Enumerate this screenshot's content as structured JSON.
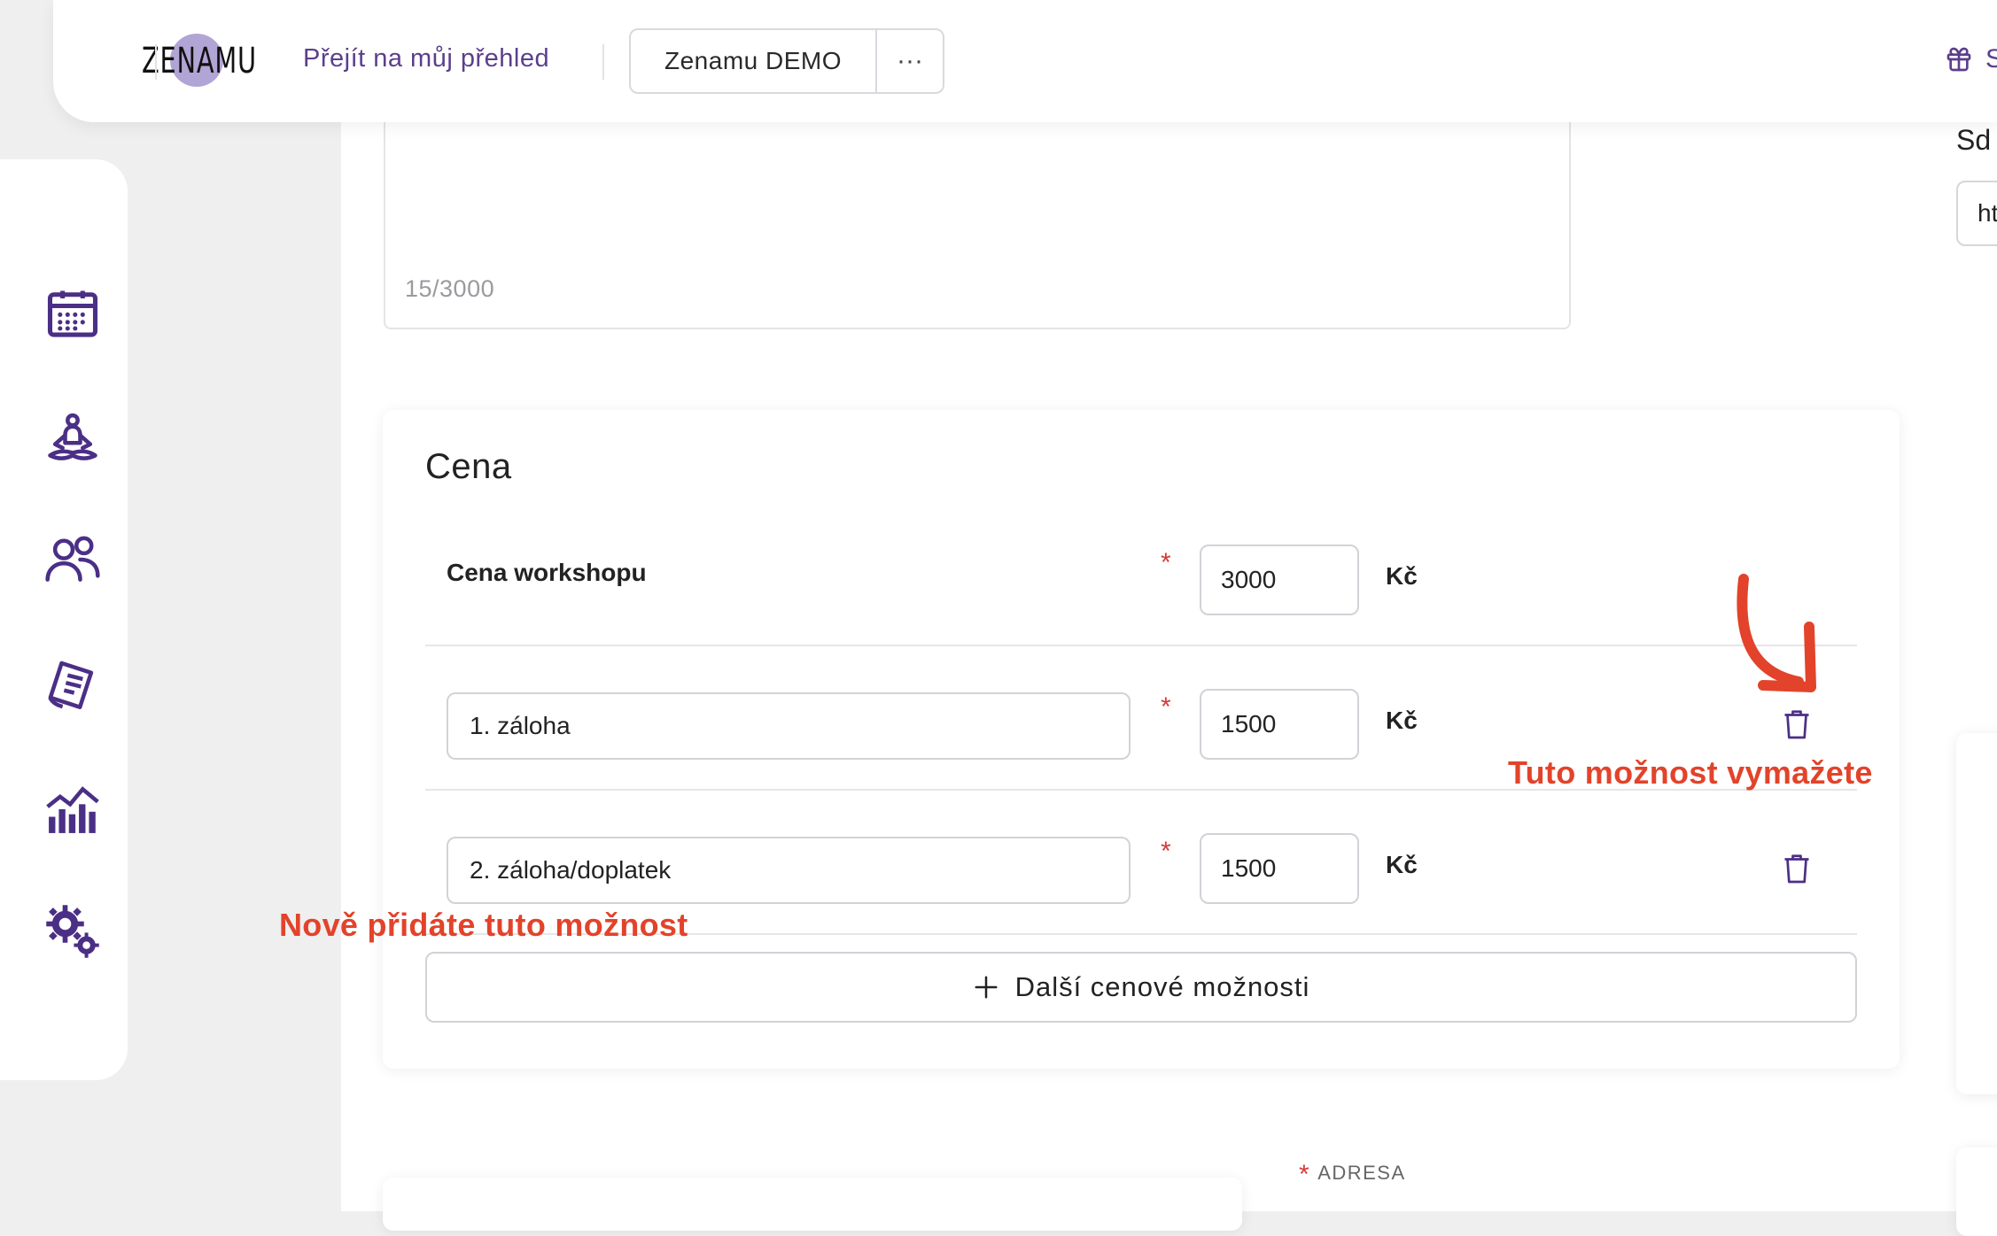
{
  "header": {
    "logo_text": "ZENAMU",
    "overview_link": "Přejít na můj přehled",
    "org_name": "Zenamu DEMO",
    "org_more": "···",
    "manage_link": "Sprá"
  },
  "sidebar": {
    "items": [
      {
        "icon": "calendar-icon"
      },
      {
        "icon": "meditation-icon"
      },
      {
        "icon": "users-icon"
      },
      {
        "icon": "document-icon"
      },
      {
        "icon": "stats-icon"
      },
      {
        "icon": "settings-icon"
      }
    ]
  },
  "description": {
    "counter": "15/3000"
  },
  "price": {
    "title": "Cena",
    "required_mark": "*",
    "rows": [
      {
        "label": "Cena workshopu",
        "amount": "3000",
        "currency": "Kč"
      },
      {
        "label": "1. záloha",
        "amount": "1500",
        "currency": "Kč"
      },
      {
        "label": "2. záloha/doplatek",
        "amount": "1500",
        "currency": "Kč"
      }
    ],
    "add_button": "Další cenové možnosti"
  },
  "annotations": {
    "delete_note": "Tuto možnost vymažete",
    "add_note": "Nově přidáte tuto možnost",
    "color": "#e2432a"
  },
  "right": {
    "section_label": "Sd",
    "input_value": "ht"
  },
  "address": {
    "label": "ADRESA"
  },
  "colors": {
    "accent": "#5b3f8c",
    "required": "#d63a3a"
  }
}
